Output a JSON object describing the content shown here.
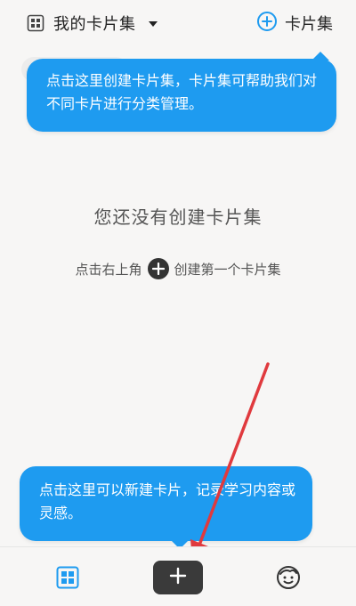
{
  "header": {
    "collection_title": "我的卡片集",
    "new_collection_label": "卡片集"
  },
  "tooltips": {
    "top": "点击这里创建卡片集，卡片集可帮助我们对不同卡片进行分类管理。",
    "bottom": "点击这里可以新建卡片，记录学习内容或灵感。"
  },
  "empty_state": {
    "title": "您还没有创建卡片集",
    "hint_before": "点击右上角",
    "hint_after": "创建第一个卡片集"
  },
  "colors": {
    "accent": "#1e9bf0",
    "tooltip": "#1e9bf0",
    "arrow": "#e03a3e",
    "dark_button": "#3a3a3a"
  },
  "icons": {
    "header_left": "grid-icon",
    "header_dropdown": "caret-down-icon",
    "header_right": "plus-circle-icon",
    "nav_left": "cards-grid-icon",
    "nav_center": "plus-icon",
    "nav_right": "smiley-face-icon"
  }
}
